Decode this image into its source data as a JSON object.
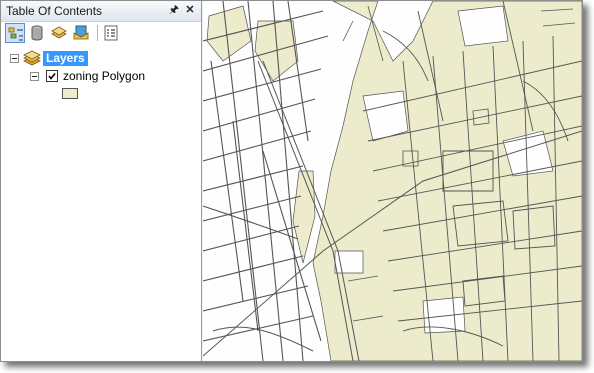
{
  "panel": {
    "title": "Table Of Contents",
    "pin_icon": "pin-icon",
    "close_icon": "close-icon"
  },
  "toolbar": {
    "buttons": [
      "list-by-drawing-order-icon",
      "list-by-source-icon",
      "list-by-visibility-icon",
      "list-by-selection-icon",
      "options-icon"
    ]
  },
  "tree": {
    "group_label": "Layers",
    "layer_label": "zoning Polygon",
    "layer_checked": true,
    "legend_fill": "#ecebcb"
  },
  "colors": {
    "map_fill": "#ecebcb",
    "map_line": "#555555",
    "selection": "#3399ff"
  }
}
